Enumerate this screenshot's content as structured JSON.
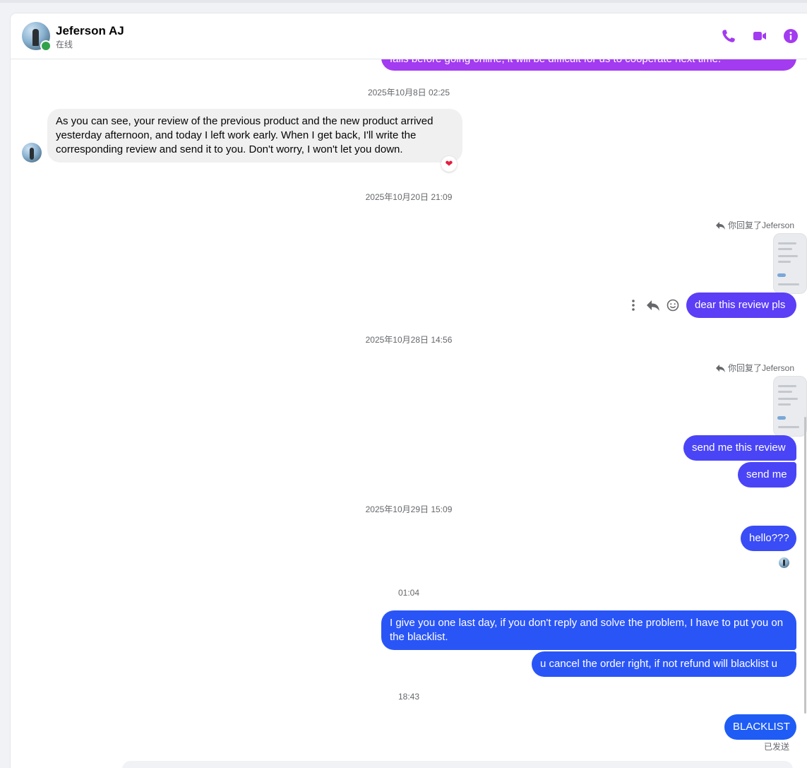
{
  "header": {
    "contact_name": "Jeferson AJ",
    "status": "在线"
  },
  "colors": {
    "accent_purple": "#a33bf0",
    "bubble_violet": "#5b3ef6",
    "bubble_blue": "#1e5cf5",
    "online": "#31a24c"
  },
  "icons": [
    "phone-icon",
    "video-call-icon",
    "info-icon",
    "reply-icon",
    "more-options-icon",
    "emoji-react-icon"
  ],
  "messages": {
    "cut_off_top": "fails before going online, it will be difficult for us to cooperate next time.",
    "ts1": "2025年10月8日 02:25",
    "in1": "As you can see, your review of the previous product and the new product arrived yesterday afternoon, and today I left work early. When I get back, I'll write the corresponding review and send it to you. Don't worry, I won't let you down.",
    "reaction1": "❤",
    "ts2": "2025年10月20日 21:09",
    "replied1": "你回复了Jeferson",
    "out1": "dear this review pls",
    "ts3": "2025年10月28日 14:56",
    "replied2": "你回复了Jeferson",
    "out2": "send me this review",
    "out3": "send me",
    "ts4": "2025年10月29日 15:09",
    "out4": "hello???",
    "ts5": "01:04",
    "out5": "I give you one last day, if you don't reply and solve the problem, I have to put you on the blacklist.",
    "out6": "u cancel the order right, if not refund will blacklist u",
    "ts6": "18:43",
    "out7": "BLACKLIST",
    "sent_status": "已发送"
  }
}
